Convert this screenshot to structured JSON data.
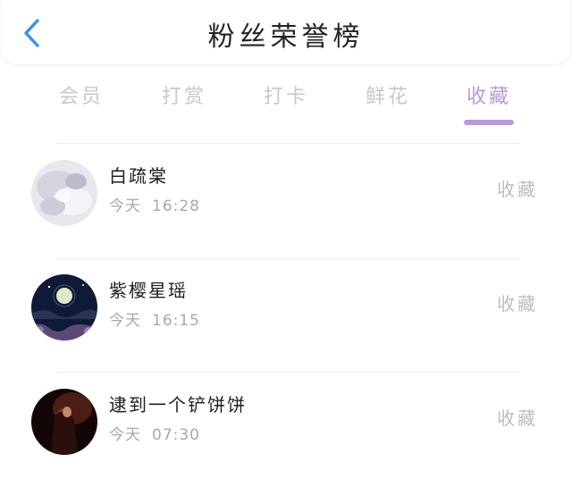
{
  "header": {
    "title": "粉丝荣誉榜",
    "back_icon": "chevron-left-icon",
    "accent": "#3b8ff5"
  },
  "tabs": [
    {
      "label": "会员",
      "active": false
    },
    {
      "label": "打赏",
      "active": false
    },
    {
      "label": "打卡",
      "active": false
    },
    {
      "label": "鲜花",
      "active": false
    },
    {
      "label": "收藏",
      "active": true
    }
  ],
  "active_color": "#b79ad7",
  "fans": [
    {
      "name": "白疏棠",
      "day": "今天",
      "time": "16:28",
      "action": "收藏",
      "avatar": "white-flower-avatar"
    },
    {
      "name": "紫樱星瑶",
      "day": "今天",
      "time": "16:15",
      "action": "收藏",
      "avatar": "moon-night-avatar"
    },
    {
      "name": "逮到一个铲饼饼",
      "day": "今天",
      "time": "07:30",
      "action": "收藏",
      "avatar": "dark-figure-avatar"
    }
  ]
}
